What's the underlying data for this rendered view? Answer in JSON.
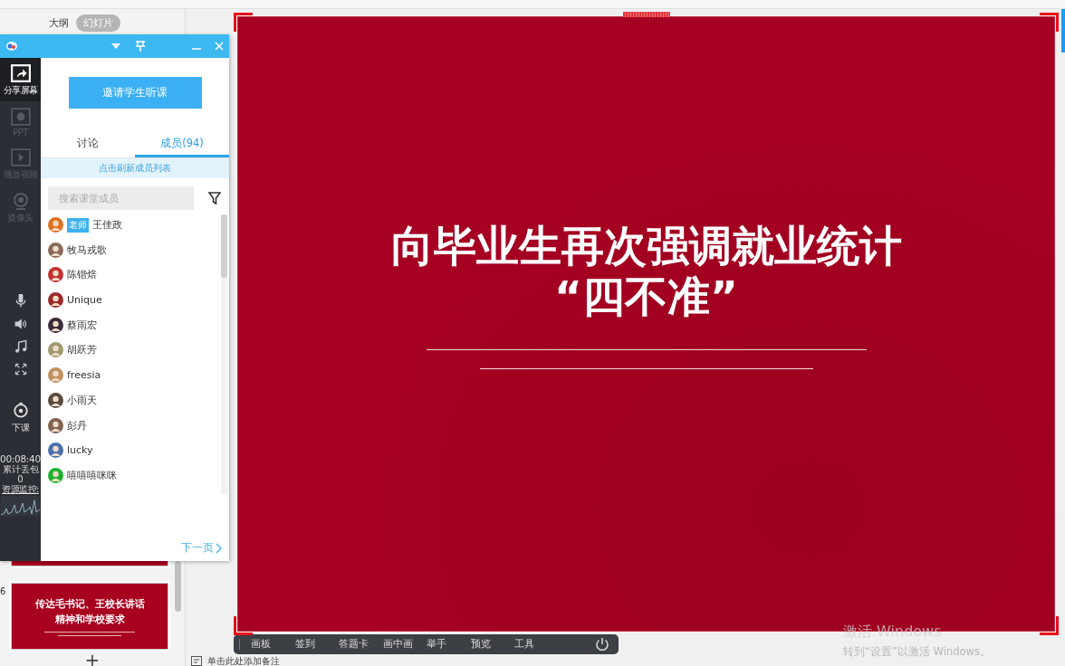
{
  "outline_tabs": [
    {
      "label": "大纲",
      "selected": false
    },
    {
      "label": "幻灯片",
      "selected": true
    }
  ],
  "slide_thumbnails": [
    {
      "kind": "partial"
    },
    {
      "kind": "full",
      "number": "6",
      "title_lines": [
        "传达毛书记、王校长讲话",
        "精神和学校要求"
      ]
    }
  ],
  "add_slide": "+",
  "panel": {
    "tools": [
      {
        "label": "分享屏幕",
        "kind": "share",
        "selected": true,
        "disabled": false
      },
      {
        "label": "PPT",
        "kind": "ppt",
        "selected": false,
        "disabled": true
      },
      {
        "label": "播放视频",
        "kind": "video",
        "selected": false,
        "disabled": true
      },
      {
        "label": "摄像头",
        "kind": "camera",
        "selected": false,
        "disabled": true
      }
    ],
    "audio_controls": [
      {
        "kind": "mic"
      },
      {
        "kind": "speaker"
      },
      {
        "kind": "music"
      },
      {
        "kind": "expand"
      }
    ],
    "end_class": "下课",
    "timer": "00:08:40",
    "packet_loss_label": "累计丢包",
    "packet_loss": "0",
    "monitor_link": "资源监控:",
    "invite_button": "邀请学生听课",
    "tabs": [
      {
        "label": "讨论",
        "selected": false
      },
      {
        "label": "成员(94)",
        "selected": true
      }
    ],
    "refresh_hint": "点击刷新成员列表",
    "search": {
      "placeholder": "搜索课堂成员"
    },
    "members": [
      {
        "name": "王佳政",
        "badge": "老师"
      },
      {
        "name": "牧马戎歌"
      },
      {
        "name": "陈锴焙"
      },
      {
        "name": "Unique"
      },
      {
        "name": "蔡雨宏"
      },
      {
        "name": "胡跃芳"
      },
      {
        "name": "freesia"
      },
      {
        "name": "小雨天"
      },
      {
        "name": "彭丹"
      },
      {
        "name": "lucky"
      },
      {
        "name": "嘻嘻嘻咪咪"
      }
    ],
    "next_page": "下一页"
  },
  "slide": {
    "title_lines": [
      "向毕业生再次强调就业统计",
      "“四不准”"
    ]
  },
  "toolbar": {
    "items": [
      "画板",
      "签到",
      "答题卡",
      "画中画",
      "举手",
      "预览",
      "工具"
    ]
  },
  "notes_placeholder": "单击此处添加备注",
  "windows_notice": {
    "title": "激活 Windows",
    "text": "转到“设置”以激活 Windows。"
  }
}
